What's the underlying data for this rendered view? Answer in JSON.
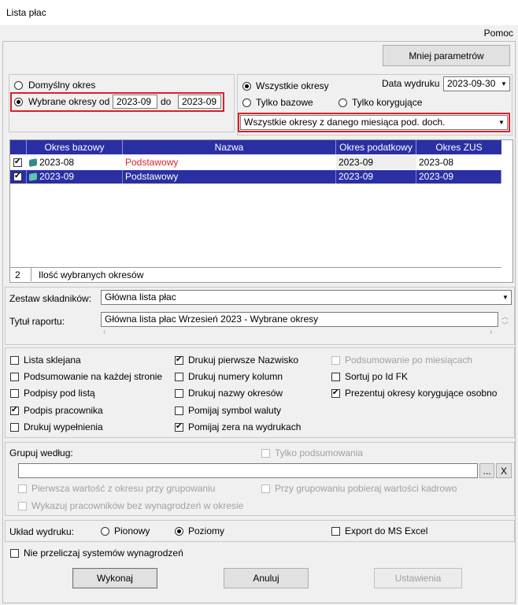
{
  "window": {
    "title": "Lista płac",
    "help": "Pomoc"
  },
  "toggle_button": "Mniej parametrów",
  "period": {
    "default_label": "Domyślny  okres",
    "selected_label": "Wybrane okresy od",
    "from": "2023-09",
    "to_label": "do",
    "to": "2023-09"
  },
  "filter": {
    "all": "Wszystkie okresy",
    "base_only": "Tylko bazowe",
    "corrective_only": "Tylko korygujące",
    "print_date_label": "Data wydruku",
    "print_date": "2023-09-30",
    "scope_value": "Wszystkie okresy z danego miesiąca pod. doch."
  },
  "grid": {
    "columns": [
      "Okres bazowy",
      "Nazwa",
      "Okres podatkowy",
      "Okres ZUS"
    ],
    "rows": [
      {
        "base": "2023-08",
        "name": "Podstawowy",
        "tax": "2023-09",
        "zus": "2023-08"
      },
      {
        "base": "2023-09",
        "name": "Podstawowy",
        "tax": "2023-09",
        "zus": "2023-09"
      }
    ],
    "footer_count": "2",
    "footer_label": "Ilość wybranych okresów"
  },
  "report": {
    "set_label": "Zestaw składników:",
    "set_value": "Główna lista płac",
    "title_label": "Tytuł raportu:",
    "title_value": "Główna lista płac Wrzesień 2023 - Wybrane okresy"
  },
  "options": {
    "col1": [
      "Lista sklejana",
      "Podsumowanie na każdej stronie",
      "Podpisy pod listą",
      "Podpis pracownika",
      "Drukuj wypełnienia"
    ],
    "col2": [
      "Drukuj pierwsze Nazwisko",
      "Drukuj numery kolumn",
      "Drukuj nazwy okresów",
      "Pomijaj symbol waluty",
      "Pomijaj zera na wydrukach"
    ],
    "col3": [
      "Podsumowanie po miesiącach",
      "Sortuj po Id FK",
      "Prezentuj okresy korygujące osobno"
    ]
  },
  "grouping": {
    "label": "Grupuj według:",
    "summary_only": "Tylko podsumowania",
    "dots": "...",
    "clear": "X",
    "first_value": "Pierwsza wartość z okresu przy grupowaniu",
    "fetch_hr": "Przy grupowaniu pobieraj wartości kadrowo",
    "show_no_pay": "Wykazuj pracowników bez wynagrodzeń w okresie"
  },
  "layout": {
    "label": "Układ wydruku:",
    "portrait": "Pionowy",
    "landscape": "Poziomy",
    "excel": "Export do MS Excel"
  },
  "no_recalc": "Nie przeliczaj systemów wynagrodzeń",
  "actions": {
    "run": "Wykonaj",
    "cancel": "Anuluj",
    "settings": "Ustawienia"
  },
  "colors": {
    "selection": "#2b2fa4",
    "highlight": "#d9202a"
  }
}
